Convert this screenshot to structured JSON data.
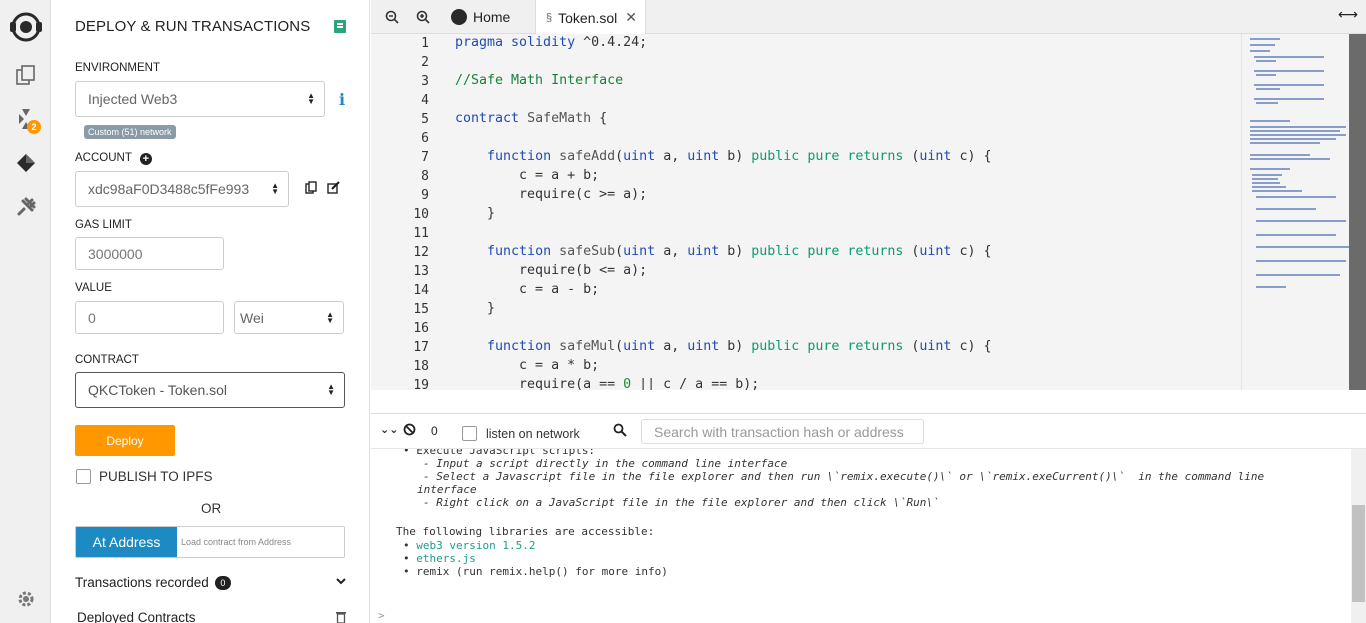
{
  "panel": {
    "title": "DEPLOY & RUN TRANSACTIONS",
    "environment_label": "ENVIRONMENT",
    "environment_value": "Injected Web3",
    "network_badge": "Custom (51) network",
    "account_label": "ACCOUNT",
    "account_value": "xdc98aF0D3488c5fFe993",
    "gas_limit_label": "GAS LIMIT",
    "gas_limit_value": "3000000",
    "value_label": "VALUE",
    "value_amount": "0",
    "value_unit": "Wei",
    "contract_label": "CONTRACT",
    "contract_value": "QKCToken - Token.sol",
    "deploy_label": "Deploy",
    "publish_label": "PUBLISH TO IPFS",
    "or_label": "OR",
    "at_address_label": "At Address",
    "at_address_placeholder": "Load contract from Address",
    "transactions_label": "Transactions recorded",
    "transactions_count": "0",
    "deployed_label": "Deployed Contracts"
  },
  "rail": {
    "plugin_badge": "2"
  },
  "tabs": {
    "home_label": "Home",
    "file_label": "Token.sol"
  },
  "editor": {
    "line_numbers": [
      "1",
      "2",
      "3",
      "4",
      "5",
      "6",
      "7",
      "8",
      "9",
      "10",
      "11",
      "12",
      "13",
      "14",
      "15",
      "16",
      "17",
      "18",
      "19"
    ]
  },
  "terminal": {
    "pending_count": "0",
    "listen_label": "listen on network",
    "search_placeholder": "Search with transaction hash or address",
    "lines": {
      "l0": "Execute JavaScript scripts:",
      "l1": "- Input a script directly in the command line interface",
      "l2": "- Select a Javascript file in the file explorer and then run \\`remix.execute()\\` or \\`remix.exeCurrent()\\`  in the command line",
      "l3": "interface",
      "l4": "- Right click on a JavaScript file in the file explorer and then click \\`Run\\`",
      "l5": "The following libraries are accessible:",
      "l6": "web3 version 1.5.2",
      "l7": "ethers.js",
      "l8": "remix (run remix.help() for more info)"
    },
    "prompt": ">"
  },
  "colors": {
    "accent": "#ff9800",
    "at_address": "#1e8ac3",
    "keyword": "#1f4bb5",
    "modifier": "#0b9b72"
  }
}
